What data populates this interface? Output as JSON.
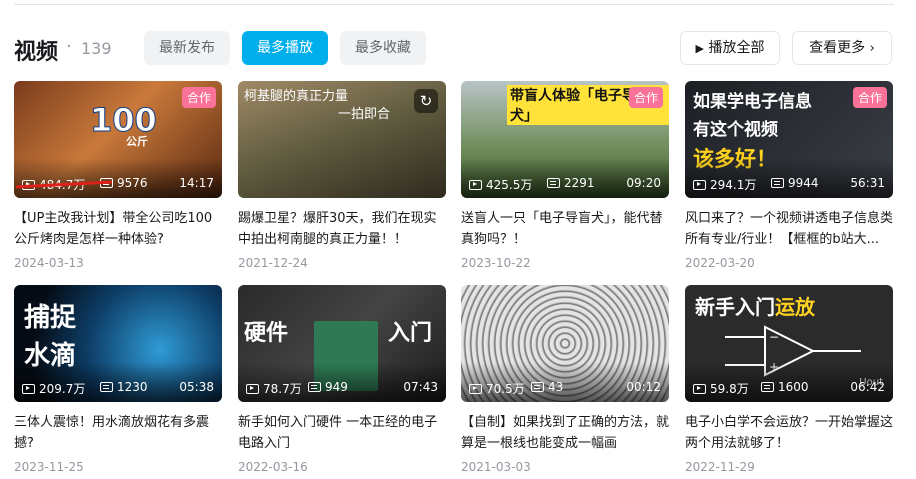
{
  "section": {
    "title": "视频",
    "separator": "·",
    "count": "139",
    "tabs": [
      {
        "label": "最新发布",
        "active": false
      },
      {
        "label": "最多播放",
        "active": true
      },
      {
        "label": "最多收藏",
        "active": false
      }
    ],
    "play_all_label": "播放全部",
    "more_label": "查看更多"
  },
  "colors": {
    "accent": "#00aeec",
    "badge": "#fb7299",
    "date": "#9499a0"
  },
  "videos": [
    {
      "title": "【UP主改我计划】带全公司吃100公斤烤肉是怎样一种体验?",
      "plays": "484.7万",
      "danmaku": "9576",
      "duration": "14:17",
      "date": "2024-03-13",
      "badge": "合作",
      "thumb_text": "100公斤"
    },
    {
      "title": "踢爆卫星？爆肝30天，我们在现实中拍出柯南腿的真正力量！！",
      "plays": "",
      "danmaku": "",
      "duration": "",
      "date": "2021-12-24",
      "badge": "",
      "thumb_text": "柯基腿的真正力量 一拍即合"
    },
    {
      "title": "送盲人一只「电子导盲犬」，能代替真狗吗？！",
      "plays": "425.5万",
      "danmaku": "2291",
      "duration": "09:20",
      "date": "2023-10-22",
      "badge": "合作",
      "thumb_text": "带盲人体验「电子导盲犬」"
    },
    {
      "title": "风口来了？一个视频讲透电子信息类所有专业/行业！【框框的b站大...",
      "plays": "294.1万",
      "danmaku": "9944",
      "duration": "56:31",
      "date": "2022-03-20",
      "badge": "合作",
      "thumb_text": "如果学电子信息 有这个视频 该多好！"
    },
    {
      "title": "三体人震惊！用水滴放烟花有多震撼?",
      "plays": "209.7万",
      "danmaku": "1230",
      "duration": "05:38",
      "date": "2023-11-25",
      "badge": "",
      "thumb_text": "捕捉 水滴"
    },
    {
      "title": "新手如何入门硬件 一本正经的电子电路入门",
      "plays": "78.7万",
      "danmaku": "949",
      "duration": "07:43",
      "date": "2022-03-16",
      "badge": "",
      "thumb_text": "硬件 入门"
    },
    {
      "title": "【自制】如果找到了正确的方法，就算是一根线也能变成一幅画",
      "plays": "70.5万",
      "danmaku": "43",
      "duration": "00:12",
      "date": "2021-03-03",
      "badge": "",
      "thumb_text": ""
    },
    {
      "title": "电子小白学不会运放？一开始掌握这两个用法就够了！",
      "plays": "59.8万",
      "danmaku": "1600",
      "duration": "06:42",
      "date": "2022-11-29",
      "badge": "",
      "thumb_text": "新手入门运放"
    }
  ]
}
